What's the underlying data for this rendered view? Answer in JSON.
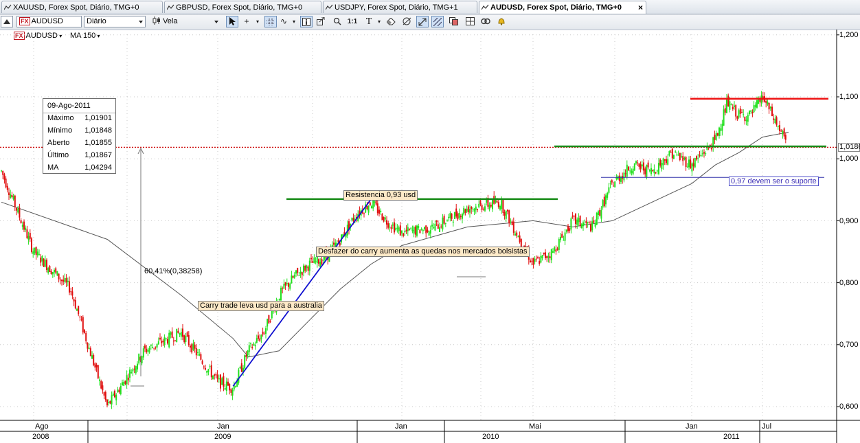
{
  "tabs": [
    {
      "label": "XAUUSD, Forex Spot, Diário, TMG+0",
      "active": false
    },
    {
      "label": "GBPUSD, Forex Spot, Diário, TMG+0",
      "active": false
    },
    {
      "label": "USDJPY, Forex Spot, Diário, TMG+1",
      "active": false
    },
    {
      "label": "AUDUSD, Forex Spot, Diário, TMG+0",
      "active": true
    }
  ],
  "tab_close_glyph": "×",
  "toolbar": {
    "symbol_badge": "FX",
    "symbol": "AUDUSD",
    "period": "Diário",
    "chart_type": "Vela",
    "icons": [
      "cursor-icon",
      "crosshair-icon",
      "grid-icon",
      "info-icon",
      "data-window-icon",
      "zoom-icon",
      "one-to-one-icon",
      "text-icon",
      "eraser-icon",
      "drawing-tools-icon",
      "auto-scale-icon",
      "pattern-icon",
      "template-icon",
      "layout-icon",
      "link-icon",
      "alert-icon"
    ]
  },
  "legend": {
    "symbol_badge": "FX",
    "symbol": "AUDUSD",
    "indicator": "MA 150"
  },
  "infobox": {
    "date": "09-Ago-2011",
    "rows": [
      {
        "label": "Máximo",
        "value": "1,01901"
      },
      {
        "label": "Mínimo",
        "value": "1,01848"
      },
      {
        "label": "Aberto",
        "value": "1,01855"
      },
      {
        "label": "Último",
        "value": "1,01867"
      },
      {
        "label": "MA",
        "value": "1,04294"
      }
    ]
  },
  "annotations": {
    "resistance": "Resistencia  0,93 usd",
    "carry_unwind": "Desfazer do carry aumenta as quedas nos mercados bolsistas",
    "carry_trade": "Carry trade leva usd para a australia",
    "support": "0,97 devem ser o suporte",
    "percent_move": "60,41%(0,38258)"
  },
  "price_axis": {
    "labels": [
      "1,200",
      "1,100",
      "1,000",
      "0,900",
      "0,800",
      "0,700",
      "0,600"
    ],
    "current": "1,0186"
  },
  "time_axis": {
    "months": [
      "Ago",
      "Jan",
      "Jan",
      "Mai",
      "Jan",
      "Jul"
    ],
    "years": [
      "2008",
      "2009",
      "2010",
      "2011"
    ]
  },
  "colors": {
    "up_candle": "#22e01e",
    "down_candle": "#e01010",
    "resistance_line": "#158a15",
    "top_line": "#ee1111",
    "trend_line": "#1010d0",
    "ma_line": "#555555",
    "current_price_line": "#cc0000"
  },
  "chart_data": {
    "type": "candlestick",
    "symbol": "AUDUSD",
    "timeframe": "Diário",
    "y_range": [
      0.58,
      1.21
    ],
    "x_range": [
      "2008-07",
      "2011-08"
    ],
    "price_series": [
      {
        "date": "2008-07",
        "close": 0.98
      },
      {
        "date": "2008-08",
        "close": 0.85
      },
      {
        "date": "2008-09",
        "close": 0.79
      },
      {
        "date": "2008-10",
        "close": 0.6
      },
      {
        "date": "2008-11",
        "close": 0.69
      },
      {
        "date": "2008-12",
        "close": 0.72
      },
      {
        "date": "2009-01",
        "close": 0.64
      },
      {
        "date": "2009-02",
        "close": 0.63
      },
      {
        "date": "2009-03",
        "close": 0.69
      },
      {
        "date": "2009-04",
        "close": 0.72
      },
      {
        "date": "2009-05",
        "close": 0.78
      },
      {
        "date": "2009-06",
        "close": 0.81
      },
      {
        "date": "2009-07",
        "close": 0.83
      },
      {
        "date": "2009-08",
        "close": 0.84
      },
      {
        "date": "2009-09",
        "close": 0.87
      },
      {
        "date": "2009-10",
        "close": 0.91
      },
      {
        "date": "2009-11",
        "close": 0.93
      },
      {
        "date": "2009-12",
        "close": 0.9
      },
      {
        "date": "2010-01",
        "close": 0.88
      },
      {
        "date": "2010-02",
        "close": 0.89
      },
      {
        "date": "2010-03",
        "close": 0.92
      },
      {
        "date": "2010-04",
        "close": 0.93
      },
      {
        "date": "2010-05",
        "close": 0.83
      },
      {
        "date": "2010-06",
        "close": 0.85
      },
      {
        "date": "2010-07",
        "close": 0.9
      },
      {
        "date": "2010-08",
        "close": 0.89
      },
      {
        "date": "2010-09",
        "close": 0.96
      },
      {
        "date": "2010-10",
        "close": 0.99
      },
      {
        "date": "2010-11",
        "close": 0.98
      },
      {
        "date": "2010-12",
        "close": 1.01
      },
      {
        "date": "2011-01",
        "close": 0.99
      },
      {
        "date": "2011-02",
        "close": 1.01
      },
      {
        "date": "2011-03",
        "close": 1.03
      },
      {
        "date": "2011-04",
        "close": 1.09
      },
      {
        "date": "2011-05",
        "close": 1.07
      },
      {
        "date": "2011-06",
        "close": 1.07
      },
      {
        "date": "2011-07",
        "close": 1.1
      },
      {
        "date": "2011-08",
        "close": 1.019
      }
    ],
    "ma150_series": [
      {
        "date": "2008-07",
        "value": 0.93
      },
      {
        "date": "2008-10",
        "value": 0.87
      },
      {
        "date": "2008-12",
        "value": 0.78
      },
      {
        "date": "2009-02",
        "value": 0.71
      },
      {
        "date": "2009-03",
        "value": 0.68
      },
      {
        "date": "2009-05",
        "value": 0.69
      },
      {
        "date": "2009-07",
        "value": 0.74
      },
      {
        "date": "2009-09",
        "value": 0.79
      },
      {
        "date": "2009-11",
        "value": 0.83
      },
      {
        "date": "2010-01",
        "value": 0.86
      },
      {
        "date": "2010-03",
        "value": 0.89
      },
      {
        "date": "2010-05",
        "value": 0.9
      },
      {
        "date": "2010-07",
        "value": 0.89
      },
      {
        "date": "2010-09",
        "value": 0.9
      },
      {
        "date": "2010-11",
        "value": 0.93
      },
      {
        "date": "2011-01",
        "value": 0.96
      },
      {
        "date": "2011-03",
        "value": 0.99
      },
      {
        "date": "2011-05",
        "value": 1.01
      },
      {
        "date": "2011-07",
        "value": 1.035
      },
      {
        "date": "2011-08",
        "value": 1.043
      }
    ],
    "horizontal_lines": [
      {
        "name": "resistance",
        "value": 0.935
      },
      {
        "name": "resistance_2011",
        "value": 1.02
      },
      {
        "name": "support",
        "value": 0.97
      },
      {
        "name": "top",
        "value": 1.097
      },
      {
        "name": "current",
        "value": 1.0186
      }
    ],
    "trend_line": {
      "from": {
        "date": "2009-02",
        "value": 0.633
      },
      "to": {
        "date": "2009-11",
        "value": 0.935
      }
    },
    "grid": true
  }
}
